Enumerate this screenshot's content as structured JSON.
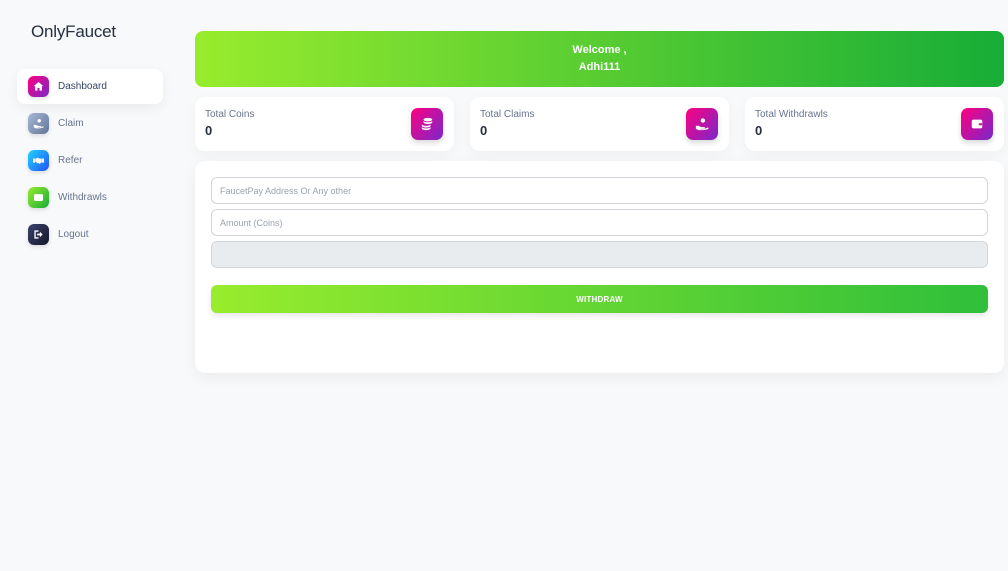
{
  "brand": {
    "name": "OnlyFaucet"
  },
  "sidebar": {
    "items": [
      {
        "label": "Dashboard",
        "icon": "home-icon"
      },
      {
        "label": "Claim",
        "icon": "hand-coin-icon"
      },
      {
        "label": "Refer",
        "icon": "handshake-icon"
      },
      {
        "label": "Withdrawls",
        "icon": "wallet-icon"
      },
      {
        "label": "Logout",
        "icon": "logout-icon"
      }
    ]
  },
  "welcome": {
    "line1": "Welcome ,",
    "username": "Adhi111"
  },
  "stats": [
    {
      "title": "Total Coins",
      "value": "0",
      "icon": "coins-icon"
    },
    {
      "title": "Total Claims",
      "value": "0",
      "icon": "hand-coin-icon"
    },
    {
      "title": "Total Withdrawls",
      "value": "0",
      "icon": "wallet-icon"
    }
  ],
  "form": {
    "address_placeholder": "FaucetPay Address Or Any other",
    "amount_placeholder": "Amount (Coins)",
    "withdraw_label": "WITHDRAW"
  },
  "colors": {
    "accent_green_start": "#98ec2d",
    "accent_green_end": "#17ad37",
    "icon_pink": "#ff0080",
    "icon_purple": "#7928ca"
  }
}
